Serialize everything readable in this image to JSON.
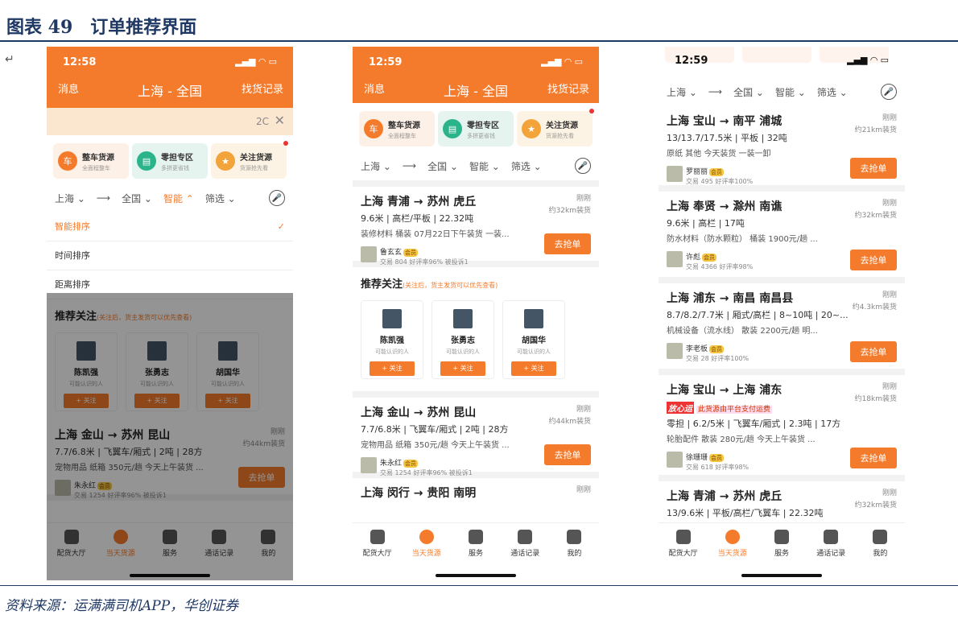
{
  "figure": {
    "title": "图表 49　订单推荐界面",
    "return_mark": "↵",
    "source": "资料来源：运满满司机APP，华创证券"
  },
  "phone1": {
    "time": "12:58",
    "signal": "▂▄▆ ◠ ▭",
    "nav_left": "消息",
    "nav_center": "上海 - 全国",
    "nav_right": "找货记录",
    "notice_text": "2C",
    "notice_close": "✕",
    "cats": [
      {
        "icon": "车",
        "t1": "整车货源",
        "t2": "全面程整车"
      },
      {
        "icon": "▤",
        "t1": "零担专区",
        "t2": "多拼更省钱"
      },
      {
        "icon": "★",
        "t1": "关注货源",
        "t2": "货源抢先看"
      }
    ],
    "filter": [
      "上海 ⌄",
      "⟶",
      "全国 ⌄",
      "智能 ⌃",
      "筛选 ⌄"
    ],
    "mic": "🎤",
    "sort": [
      "智能排序",
      "时间排序",
      "距离排序"
    ],
    "check": "✓",
    "rec_title": "推荐关注",
    "rec_hint": "(关注后，货主发货可以优先查看)",
    "rec": [
      {
        "name": "陈凯强",
        "sub": "可能认识的人",
        "btn": "+ 关注"
      },
      {
        "name": "张勇志",
        "sub": "可能认识的人",
        "btn": "+ 关注"
      },
      {
        "name": "胡国华",
        "sub": "可能认识的人",
        "btn": "+ 关注"
      }
    ],
    "card": {
      "route": "上海 金山 → 苏州 昆山",
      "spec": "7.7/6.8米 | 飞翼车/厢式 | 2吨 | 28方",
      "desc": "宠物用品 纸箱 350元/趟 今天上午装货 ...",
      "owner": "朱永红",
      "vip": "会员",
      "stat": "交易 1254 好评率96% 被投诉1",
      "time": "刚刚",
      "dist": "约44km装货",
      "grab": "去抢单"
    }
  },
  "phone2": {
    "time": "12:59",
    "signal": "▂▄▆ ◠ ▭",
    "nav_left": "消息",
    "nav_center": "上海 - 全国",
    "nav_right": "找货记录",
    "cats": [
      {
        "icon": "车",
        "t1": "整车货源",
        "t2": "全面程整车"
      },
      {
        "icon": "▤",
        "t1": "零担专区",
        "t2": "多拼更省钱"
      },
      {
        "icon": "★",
        "t1": "关注货源",
        "t2": "货源抢先看"
      }
    ],
    "filter": [
      "上海 ⌄",
      "⟶",
      "全国 ⌄",
      "智能 ⌄",
      "筛选 ⌄"
    ],
    "mic": "🎤",
    "card1": {
      "route": "上海 青浦 → 苏州 虎丘",
      "spec": "9.6米 | 高栏/平板 | 22.32吨",
      "desc": "装修材料 桶装 07月22日下午装货 一装...",
      "owner": "鲁玄玄",
      "vip": "会员",
      "stat": "交易 804 好评率96% 被投诉1",
      "time": "刚刚",
      "dist": "约32km装货",
      "grab": "去抢单"
    },
    "rec_title": "推荐关注",
    "rec_hint": "(关注后，货主发货可以优先查看)",
    "rec": [
      {
        "name": "陈凯强",
        "sub": "可能认识的人",
        "btn": "+ 关注"
      },
      {
        "name": "张勇志",
        "sub": "可能认识的人",
        "btn": "+ 关注"
      },
      {
        "name": "胡国华",
        "sub": "可能认识的人",
        "btn": "+ 关注"
      }
    ],
    "card2": {
      "route": "上海 金山 → 苏州 昆山",
      "spec": "7.7/6.8米 | 飞翼车/厢式 | 2吨 | 28方",
      "desc": "宠物用品 纸箱 350元/趟 今天上午装货 ...",
      "owner": "朱永红",
      "vip": "会员",
      "stat": "交易 1254 好评率96% 被投诉1",
      "time": "刚刚",
      "dist": "约44km装货",
      "grab": "去抢单"
    },
    "card3": {
      "route": "上海 闵行 → 贵阳 南明",
      "time": "刚刚"
    }
  },
  "phone3": {
    "time": "12:59",
    "signal": "▂▄▆ ◠ ▭",
    "filter": [
      "上海 ⌄",
      "⟶",
      "全国 ⌄",
      "智能 ⌄",
      "筛选 ⌄"
    ],
    "mic": "🎤",
    "cards": [
      {
        "route": "上海 宝山 → 南平 浦城",
        "spec": "13/13.7/17.5米 | 平板 | 32吨",
        "desc": "原纸 其他 今天装货 一装一卸",
        "owner": "罗丽丽",
        "vip": "会员",
        "stat": "交易 495 好评率100%",
        "time": "刚刚",
        "dist": "约21km装货",
        "grab": "去抢单"
      },
      {
        "route": "上海 奉贤 → 滁州 南谯",
        "spec": "9.6米 | 高栏 | 17吨",
        "desc": "防水材料（防水颗粒） 桶装 1900元/趟 ...",
        "owner": "许彪",
        "vip": "会员",
        "stat": "交易 4366 好评率98%",
        "time": "刚刚",
        "dist": "约32km装货",
        "grab": "去抢单"
      },
      {
        "route": "上海 浦东 → 南昌 南昌县",
        "spec": "8.7/8.2/7.7米 | 厢式/高栏 | 8~10吨 | 20~...",
        "desc": "机械设备（流水线） 散装 2200元/趟 明...",
        "owner": "李老板",
        "vip": "会员",
        "stat": "交易 28 好评率100%",
        "time": "刚刚",
        "dist": "约4.3km装货",
        "grab": "去抢单"
      },
      {
        "route": "上海 宝山 → 上海 浦东",
        "tag": "放心运",
        "notice": "此货源由平台支付运费",
        "spec": "零担 | 6.2/5米 | 飞翼车/厢式 | 2.3吨 | 17方",
        "desc": "轮胎配件 散装 280元/趟 今天上午装货 ...",
        "owner": "徐珊珊",
        "vip": "会员",
        "stat": "交易 618 好评率98%",
        "time": "刚刚",
        "dist": "约18km装货",
        "grab": "去抢单"
      },
      {
        "route": "上海 青浦 → 苏州 虎丘",
        "spec": "13/9.6米 | 平板/高栏/飞翼车 | 22.32吨",
        "time": "刚刚",
        "dist": "约32km装货"
      }
    ]
  },
  "tabs": [
    "配货大厅",
    "当天货源",
    "服务",
    "通话记录",
    "我的"
  ]
}
